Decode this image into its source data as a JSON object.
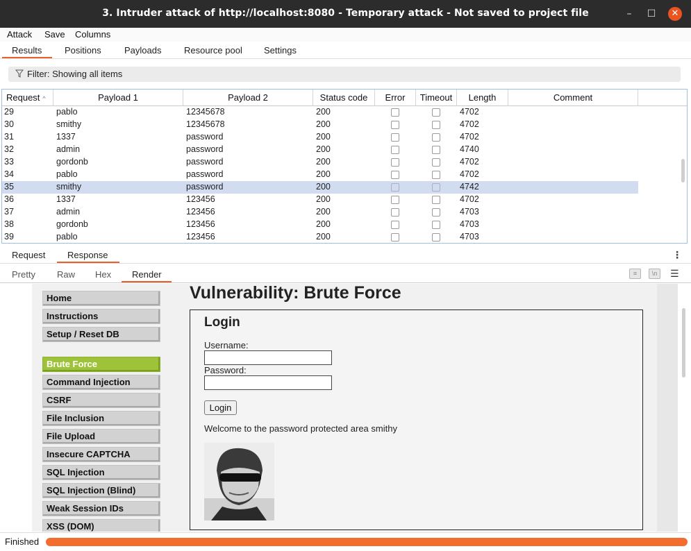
{
  "window": {
    "title": "3. Intruder attack of http://localhost:8080 - Temporary attack - Not saved to project file",
    "minimize": "–",
    "maximize": "☐",
    "close": "✕"
  },
  "menubar": [
    "Attack",
    "Save",
    "Columns"
  ],
  "tabs": [
    "Results",
    "Positions",
    "Payloads",
    "Resource pool",
    "Settings"
  ],
  "active_tab": "Results",
  "filter": {
    "text": "Filter: Showing all items"
  },
  "table": {
    "columns": [
      "Request",
      "Payload 1",
      "Payload 2",
      "Status code",
      "Error",
      "Timeout",
      "Length",
      "Comment"
    ],
    "sort_indicator": "^",
    "selected_request": "35",
    "rows": [
      {
        "request": "29",
        "p1": "pablo",
        "p2": "12345678",
        "status": "200",
        "length": "4702"
      },
      {
        "request": "30",
        "p1": "smithy",
        "p2": "12345678",
        "status": "200",
        "length": "4702"
      },
      {
        "request": "31",
        "p1": "1337",
        "p2": "password",
        "status": "200",
        "length": "4702"
      },
      {
        "request": "32",
        "p1": "admin",
        "p2": "password",
        "status": "200",
        "length": "4740"
      },
      {
        "request": "33",
        "p1": "gordonb",
        "p2": "password",
        "status": "200",
        "length": "4702"
      },
      {
        "request": "34",
        "p1": "pablo",
        "p2": "password",
        "status": "200",
        "length": "4702"
      },
      {
        "request": "35",
        "p1": "smithy",
        "p2": "password",
        "status": "200",
        "length": "4742"
      },
      {
        "request": "36",
        "p1": "1337",
        "p2": "123456",
        "status": "200",
        "length": "4702"
      },
      {
        "request": "37",
        "p1": "admin",
        "p2": "123456",
        "status": "200",
        "length": "4703"
      },
      {
        "request": "38",
        "p1": "gordonb",
        "p2": "123456",
        "status": "200",
        "length": "4703"
      },
      {
        "request": "39",
        "p1": "pablo",
        "p2": "123456",
        "status": "200",
        "length": "4703"
      }
    ]
  },
  "rr_tabs": [
    "Request",
    "Response"
  ],
  "rr_active": "Response",
  "view_tabs": [
    "Pretty",
    "Raw",
    "Hex",
    "Render"
  ],
  "view_active": "Render",
  "view_icons": [
    "wrap-icon",
    "newline-icon",
    "menu-icon"
  ],
  "render": {
    "heading": "Vulnerability: Brute Force",
    "menu": [
      "Home",
      "Instructions",
      "Setup / Reset DB",
      "Brute Force",
      "Command Injection",
      "CSRF",
      "File Inclusion",
      "File Upload",
      "Insecure CAPTCHA",
      "SQL Injection",
      "SQL Injection (Blind)",
      "Weak Session IDs",
      "XSS (DOM)"
    ],
    "active_menu": "Brute Force",
    "login": {
      "title": "Login",
      "username_label": "Username:",
      "password_label": "Password:",
      "button": "Login",
      "welcome": "Welcome to the password protected area smithy"
    }
  },
  "status": {
    "text": "Finished",
    "progress": 1.0,
    "color": "#f26d2e"
  }
}
